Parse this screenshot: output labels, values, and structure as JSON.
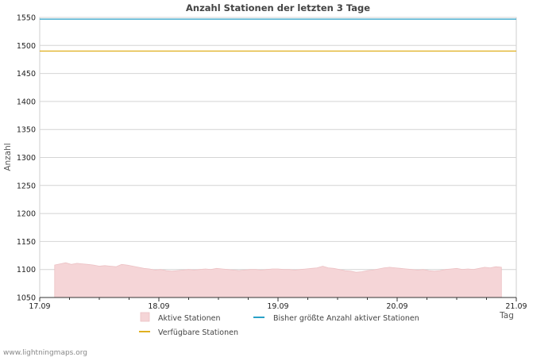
{
  "chart_data": {
    "type": "area",
    "title": "Anzahl Stationen der letzten 3 Tage",
    "xlabel": "Tag",
    "ylabel": "Anzahl",
    "ylim": [
      1050,
      1550
    ],
    "yticks": [
      1550,
      1500,
      1450,
      1400,
      1350,
      1300,
      1250,
      1200,
      1150,
      1100,
      1050
    ],
    "xlim": [
      "17.09",
      "21.09"
    ],
    "xticks": [
      "17.09",
      "18.09",
      "19.09",
      "20.09",
      "21.09"
    ],
    "grid": true,
    "legend_position": "bottom",
    "series": [
      {
        "name": "Aktive Stationen",
        "kind": "area",
        "color": "#f5d5d7",
        "edge_color": "#ecc1c4",
        "x_start": "17.09 03:00",
        "x_end": "20.09 21:00",
        "values": [
          1108,
          1110,
          1112,
          1109,
          1111,
          1110,
          1109,
          1108,
          1106,
          1107,
          1106,
          1105,
          1109,
          1108,
          1106,
          1104,
          1102,
          1101,
          1099,
          1100,
          1098,
          1097,
          1098,
          1099,
          1100,
          1099,
          1100,
          1101,
          1100,
          1102,
          1101,
          1100,
          1099,
          1098,
          1099,
          1100,
          1100,
          1099,
          1100,
          1101,
          1101,
          1100,
          1100,
          1099,
          1100,
          1101,
          1102,
          1103,
          1106,
          1103,
          1102,
          1100,
          1098,
          1097,
          1095,
          1096,
          1098,
          1099,
          1101,
          1103,
          1104,
          1103,
          1102,
          1101,
          1100,
          1099,
          1100,
          1098,
          1097,
          1098,
          1100,
          1101,
          1102,
          1100,
          1101,
          1100,
          1102,
          1104,
          1103,
          1105,
          1104
        ]
      },
      {
        "name": "Bisher größte Anzahl aktiver Stationen",
        "kind": "line",
        "color": "#2aa1c7",
        "value": 1547
      },
      {
        "name": "Verfügbare Stationen",
        "kind": "line",
        "color": "#e0b020",
        "value": 1490
      }
    ]
  },
  "footer": "www.lightningmaps.org"
}
